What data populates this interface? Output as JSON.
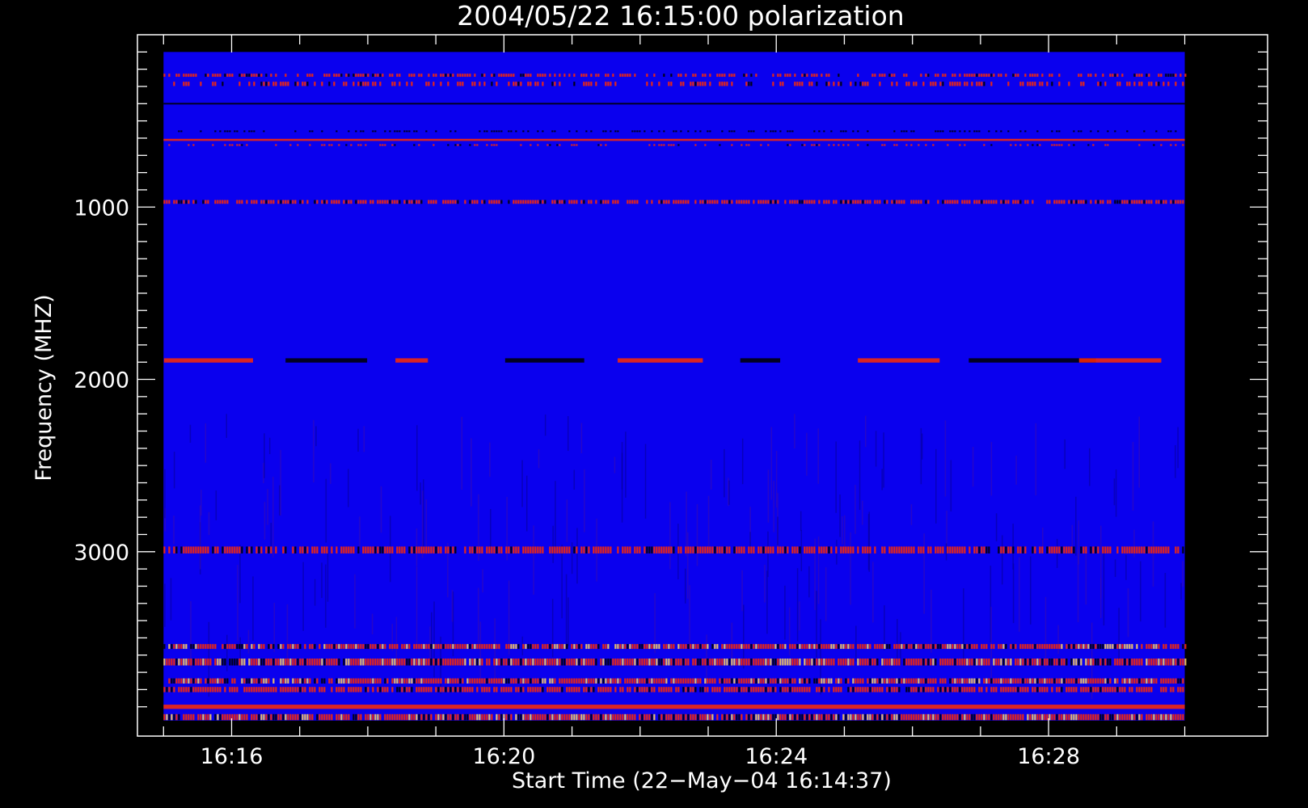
{
  "chart_data": {
    "type": "heatmap",
    "title": "2004/05/22 16:15:00 polarization",
    "xlabel": "Start Time (22−May−04 16:14:37)",
    "ylabel": "Frequency (MHZ)",
    "x_range": [
      "16:14:37",
      "16:31:13"
    ],
    "x_ticks": [
      {
        "time": "16:16",
        "label": "16:16"
      },
      {
        "time": "16:20",
        "label": "16:20"
      },
      {
        "time": "16:24",
        "label": "16:24"
      },
      {
        "time": "16:28",
        "label": "16:28"
      }
    ],
    "y_range_mhz": [
      0,
      4070
    ],
    "y_inverted": true,
    "y_ticks": [
      {
        "value": 1000,
        "label": "1000"
      },
      {
        "value": 2000,
        "label": "2000"
      },
      {
        "value": 3000,
        "label": "3000"
      }
    ],
    "data_extent": {
      "time_start": "16:15:00",
      "time_end": "16:30:00",
      "freq_start_mhz": 100,
      "freq_end_mhz": 3980
    },
    "colormap": {
      "background": "#0a00ee",
      "positive": "#ff2a00",
      "strong": "#ffd060",
      "negative": "#000000"
    },
    "bands": [
      {
        "freq_mhz": 235,
        "width_mhz": 18,
        "intensity": 0.9,
        "style": "dash",
        "coverage": 0.6
      },
      {
        "freq_mhz": 285,
        "width_mhz": 25,
        "intensity": 0.5,
        "style": "dash",
        "coverage": 0.45
      },
      {
        "freq_mhz": 400,
        "width_mhz": 8,
        "intensity": -0.7,
        "style": "solid",
        "coverage": 0.9
      },
      {
        "freq_mhz": 560,
        "width_mhz": 8,
        "intensity": -0.5,
        "style": "dash",
        "coverage": 0.35
      },
      {
        "freq_mhz": 610,
        "width_mhz": 12,
        "intensity": 0.9,
        "style": "solid",
        "coverage": 0.95
      },
      {
        "freq_mhz": 640,
        "width_mhz": 10,
        "intensity": 0.85,
        "style": "dash",
        "coverage": 0.3
      },
      {
        "freq_mhz": 970,
        "width_mhz": 22,
        "intensity": 0.75,
        "style": "dash",
        "coverage": 0.75
      },
      {
        "freq_mhz": 1890,
        "width_mhz": 25,
        "intensity": 0.9,
        "style": "segments",
        "coverage": 0.5
      },
      {
        "freq_mhz": 2990,
        "width_mhz": 40,
        "intensity": 0.85,
        "style": "dash",
        "coverage": 0.8
      },
      {
        "freq_mhz": 3550,
        "width_mhz": 28,
        "intensity": 1.0,
        "style": "dash",
        "coverage": 0.9
      },
      {
        "freq_mhz": 3640,
        "width_mhz": 40,
        "intensity": 1.0,
        "style": "dash",
        "coverage": 0.95
      },
      {
        "freq_mhz": 3750,
        "width_mhz": 30,
        "intensity": 1.0,
        "style": "dash",
        "coverage": 0.9
      },
      {
        "freq_mhz": 3800,
        "width_mhz": 30,
        "intensity": 0.9,
        "style": "dash",
        "coverage": 0.85
      },
      {
        "freq_mhz": 3900,
        "width_mhz": 25,
        "intensity": 1.0,
        "style": "solid",
        "coverage": 1.0
      },
      {
        "freq_mhz": 3960,
        "width_mhz": 35,
        "intensity": 1.0,
        "style": "dash",
        "coverage": 0.95
      }
    ]
  }
}
